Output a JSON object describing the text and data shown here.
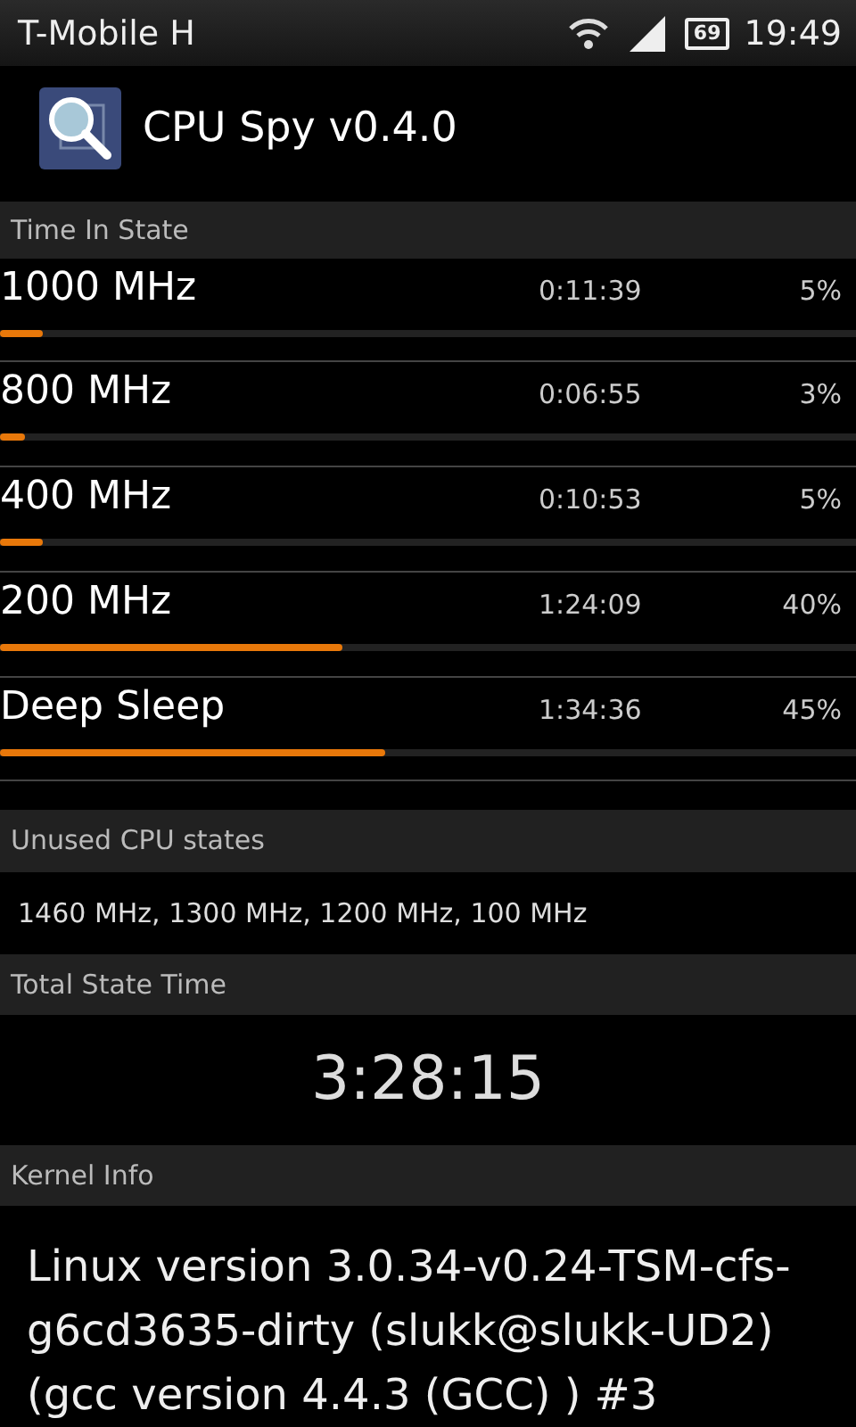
{
  "status_bar": {
    "carrier": "T-Mobile H",
    "battery": "69",
    "time": "19:49"
  },
  "app_bar": {
    "title": "CPU Spy v0.4.0"
  },
  "sections": [
    {
      "kind": "states",
      "title": "Time In State",
      "rows": [
        {
          "name": "1000 MHz",
          "time": "0:11:39",
          "percent": "5%",
          "level": 0.05
        },
        {
          "name": "800 MHz",
          "time": "0:06:55",
          "percent": "3%",
          "level": 0.03
        },
        {
          "name": "400 MHz",
          "time": "0:10:53",
          "percent": "5%",
          "level": 0.05
        },
        {
          "name": "200 MHz",
          "time": "1:24:09",
          "percent": "40%",
          "level": 0.4
        },
        {
          "name": "Deep Sleep",
          "time": "1:34:36",
          "percent": "45%",
          "level": 0.45
        }
      ]
    },
    {
      "kind": "list",
      "title": "Unused CPU states",
      "text": "1460 MHz, 1300 MHz, 1200 MHz, 100 MHz"
    },
    {
      "kind": "total",
      "title": "Total State Time",
      "text": "3:28:15"
    },
    {
      "kind": "kernel",
      "title": "Kernel Info",
      "text": "Linux version 3.0.34-v0.24-TSM-cfs-g6cd3635-dirty (slukk@slukk-UD2) (gcc version 4.4.3 (GCC) ) #3"
    }
  ]
}
